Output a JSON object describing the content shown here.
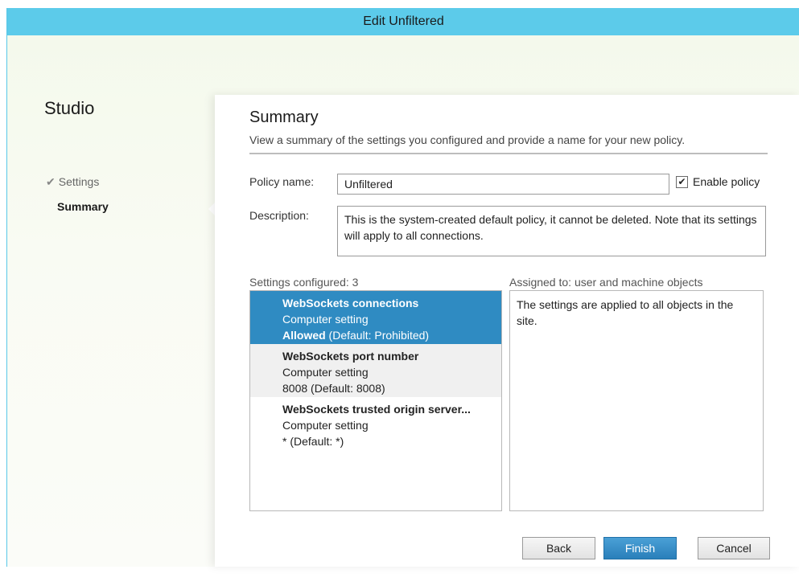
{
  "window": {
    "title": "Edit Unfiltered"
  },
  "sidebar": {
    "app_name": "Studio",
    "items": [
      {
        "label": "Settings",
        "completed": true,
        "check_glyph": "✔"
      },
      {
        "label": "Summary",
        "active": true
      }
    ]
  },
  "main": {
    "heading": "Summary",
    "subheading": "View a summary of the settings you configured and provide a name for your new policy.",
    "policy_name_label": "Policy name:",
    "policy_name_value": "Unfiltered",
    "enable_policy_label": "Enable policy",
    "enable_policy_checked": true,
    "check_glyph": "✔",
    "description_label": "Description:",
    "description_value": "This is the system-created default policy, it cannot be deleted. Note that its settings will apply to all connections.",
    "settings_configured_label": "Settings configured: 3",
    "assigned_to_label": "Assigned to:  user and machine objects",
    "assigned_text": "The settings are applied to all objects in the site.",
    "settings": [
      {
        "name": "WebSockets connections",
        "type": "Computer setting",
        "value": "Allowed",
        "default": " (Default: Prohibited)",
        "selected": true
      },
      {
        "name": "WebSockets port number",
        "type": "Computer setting",
        "value": "8008",
        "default": " (Default: 8008)",
        "selected": false
      },
      {
        "name": "WebSockets trusted origin server...",
        "type": "Computer setting",
        "value": "*",
        "default": " (Default: *)",
        "selected": false
      }
    ]
  },
  "buttons": {
    "back": "Back",
    "finish": "Finish",
    "cancel": "Cancel"
  },
  "colors": {
    "title_bar": "#5ccbea",
    "selection": "#2f8bc2",
    "primary_button": "#2a7fba"
  }
}
